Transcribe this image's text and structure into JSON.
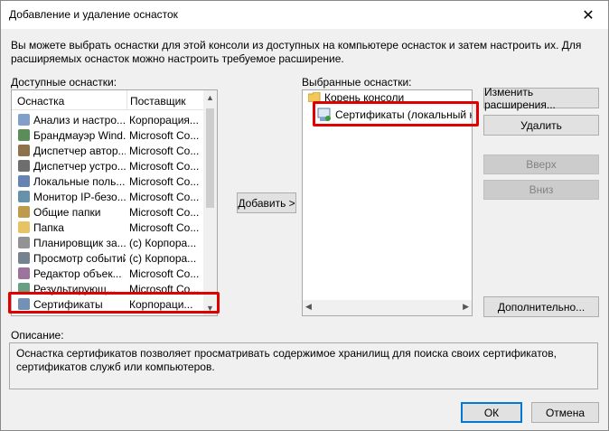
{
  "window": {
    "title": "Добавление и удаление оснасток",
    "close_glyph": "✕"
  },
  "intro": "Вы можете выбрать оснастки для этой консоли из доступных на компьютере оснасток и затем настроить их. Для расширяемых оснасток можно настроить требуемое расширение.",
  "available": {
    "label": "Доступные оснастки:",
    "col_name": "Оснастка",
    "col_provider": "Поставщик",
    "items": [
      {
        "name": "Анализ и настро...",
        "provider": "Корпорация...",
        "icon": "shield-icon"
      },
      {
        "name": "Брандмауэр Wind...",
        "provider": "Microsoft Co...",
        "icon": "firewall-icon"
      },
      {
        "name": "Диспетчер автор...",
        "provider": "Microsoft Co...",
        "icon": "manager-icon"
      },
      {
        "name": "Диспетчер устро...",
        "provider": "Microsoft Co...",
        "icon": "device-icon"
      },
      {
        "name": "Локальные поль...",
        "provider": "Microsoft Co...",
        "icon": "users-icon"
      },
      {
        "name": "Монитор IP-безо...",
        "provider": "Microsoft Co...",
        "icon": "monitor-icon"
      },
      {
        "name": "Общие папки",
        "provider": "Microsoft Co...",
        "icon": "shared-folder-icon"
      },
      {
        "name": "Папка",
        "provider": "Microsoft Co...",
        "icon": "folder-icon"
      },
      {
        "name": "Планировщик за...",
        "provider": "(с) Корпора...",
        "icon": "clock-icon"
      },
      {
        "name": "Просмотр событий",
        "provider": "(с) Корпора...",
        "icon": "event-icon"
      },
      {
        "name": "Редактор объек...",
        "provider": "Microsoft Co...",
        "icon": "editor-icon"
      },
      {
        "name": "Результирующ...",
        "provider": "Microsoft Co...",
        "icon": "result-icon"
      },
      {
        "name": "Сертификаты",
        "provider": "Корпораци...",
        "icon": "certificate-icon"
      }
    ]
  },
  "add_button": "Добавить >",
  "selected": {
    "label": "Выбранные оснастки:",
    "root": "Корень консоли",
    "child": "Сертификаты (локальный ко"
  },
  "buttons": {
    "change_ext": "Изменить расширения...",
    "remove": "Удалить",
    "up": "Вверх",
    "down": "Вниз",
    "advanced": "Дополнительно...",
    "ok": "ОК",
    "cancel": "Отмена"
  },
  "description": {
    "label": "Описание:",
    "text": "Оснастка сертификатов позволяет просматривать содержимое хранилищ для поиска своих сертификатов, сертификатов служб или компьютеров."
  },
  "colors": {
    "highlight_border": "#e00000",
    "default_button": "#0078d7"
  }
}
